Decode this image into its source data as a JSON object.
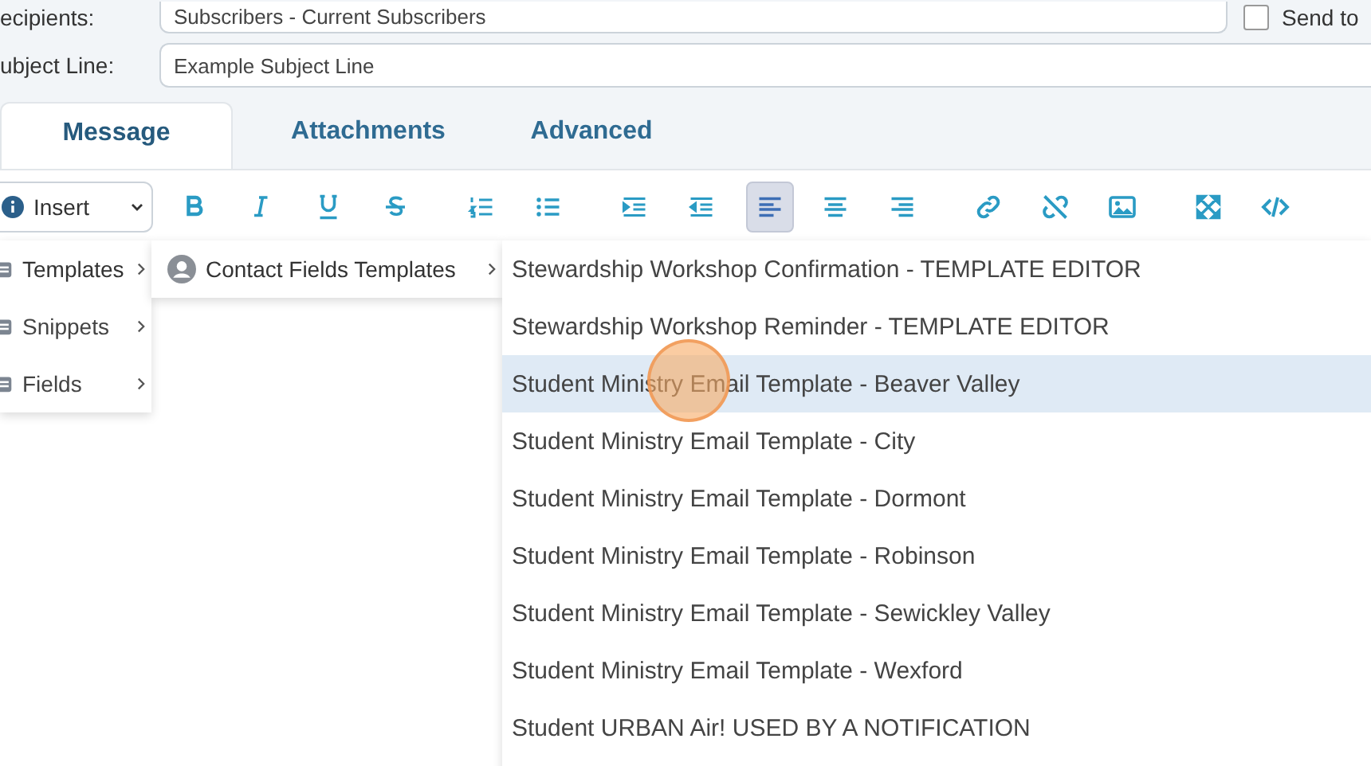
{
  "recipients": {
    "label": "ecipients:",
    "value": "Subscribers - Current Subscribers",
    "send_to_label": "Send to",
    "send_to_checked": false
  },
  "subject": {
    "label": "ubject Line:",
    "value": "Example Subject Line"
  },
  "tabs": [
    {
      "label": "Message",
      "selected": true
    },
    {
      "label": "Attachments",
      "selected": false
    },
    {
      "label": "Advanced",
      "selected": false
    }
  ],
  "insert_dropdown": {
    "label": "Insert"
  },
  "toolbar": [
    {
      "kind": "bold",
      "selected": false
    },
    {
      "kind": "italic",
      "selected": false
    },
    {
      "kind": "underline",
      "selected": false
    },
    {
      "kind": "strike",
      "selected": false
    },
    {
      "kind": "sep"
    },
    {
      "kind": "ol",
      "selected": false
    },
    {
      "kind": "ul",
      "selected": false
    },
    {
      "kind": "sep"
    },
    {
      "kind": "indent",
      "selected": false
    },
    {
      "kind": "outdent",
      "selected": false
    },
    {
      "kind": "left",
      "selected": true
    },
    {
      "kind": "center",
      "selected": false
    },
    {
      "kind": "right",
      "selected": false
    },
    {
      "kind": "sep"
    },
    {
      "kind": "link",
      "selected": false
    },
    {
      "kind": "unlink",
      "selected": false
    },
    {
      "kind": "image",
      "selected": false
    },
    {
      "kind": "sep"
    },
    {
      "kind": "fullscreen",
      "selected": false
    },
    {
      "kind": "code",
      "selected": false
    }
  ],
  "menu": [
    {
      "label": "Templates",
      "expanded": true
    },
    {
      "label": "Snippets",
      "expanded": false
    },
    {
      "label": "Fields",
      "expanded": false
    }
  ],
  "submenu": [
    {
      "label": "Contact Fields Templates",
      "expanded": true
    }
  ],
  "templates": [
    {
      "label": "Stewardship Workshop Confirmation - TEMPLATE EDITOR",
      "selected": false
    },
    {
      "label": "Stewardship Workshop Reminder - TEMPLATE EDITOR",
      "selected": false
    },
    {
      "label": "Student Ministry Email Template - Beaver Valley",
      "selected": true
    },
    {
      "label": "Student Ministry Email Template - City",
      "selected": false
    },
    {
      "label": "Student Ministry Email Template - Dormont",
      "selected": false
    },
    {
      "label": "Student Ministry Email Template - Robinson",
      "selected": false
    },
    {
      "label": "Student Ministry Email Template - Sewickley Valley",
      "selected": false
    },
    {
      "label": "Student Ministry Email Template - Wexford",
      "selected": false
    },
    {
      "label": "Student URBAN Air! USED BY A NOTIFICATION",
      "selected": false
    }
  ]
}
